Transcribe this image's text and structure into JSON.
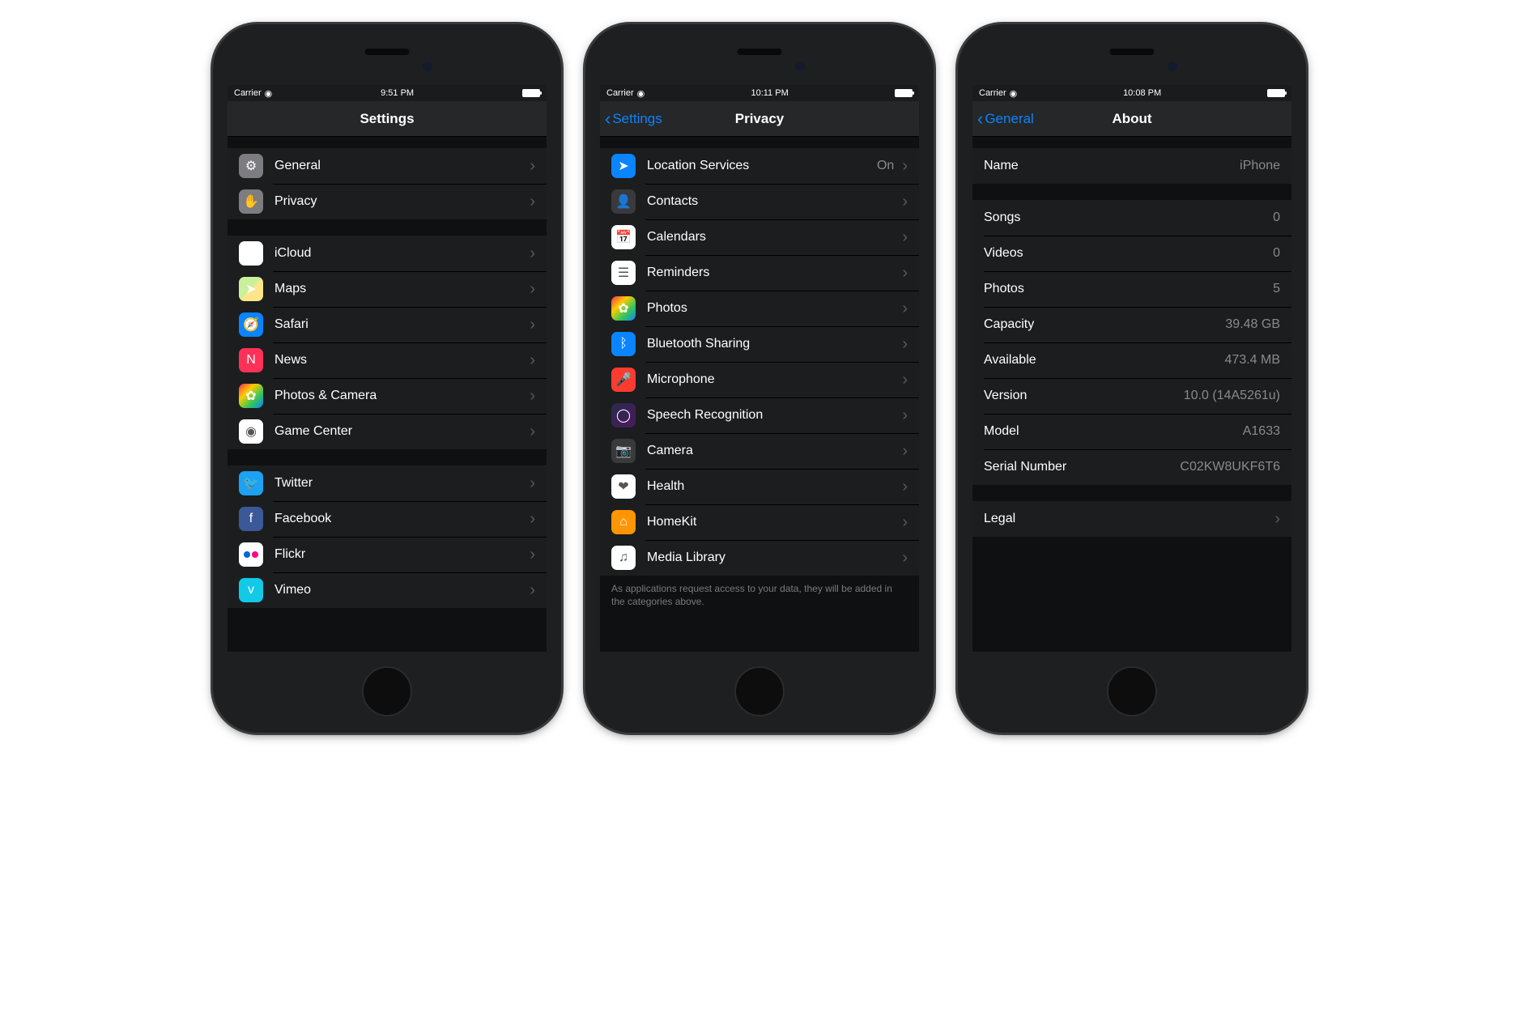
{
  "phones": [
    {
      "status": {
        "carrier": "Carrier",
        "time": "9:51 PM"
      },
      "nav": {
        "title": "Settings",
        "back": null
      },
      "groups": [
        {
          "rows": [
            {
              "icon": "gear-icon",
              "iconClass": "bg-gray",
              "glyph": "⚙",
              "label": "General",
              "disclosure": true
            },
            {
              "icon": "hand-icon",
              "iconClass": "bg-gray",
              "glyph": "✋",
              "label": "Privacy",
              "disclosure": true
            }
          ]
        },
        {
          "rows": [
            {
              "icon": "cloud-icon",
              "iconClass": "bg-icloud",
              "glyph": "☁︎",
              "label": "iCloud",
              "disclosure": true
            },
            {
              "icon": "maps-icon",
              "iconClass": "bg-maps",
              "glyph": "➤",
              "label": "Maps",
              "disclosure": true
            },
            {
              "icon": "compass-icon",
              "iconClass": "bg-blue",
              "glyph": "🧭",
              "label": "Safari",
              "disclosure": true
            },
            {
              "icon": "news-icon",
              "iconClass": "bg-news",
              "glyph": "N",
              "label": "News",
              "disclosure": true
            },
            {
              "icon": "photos-icon",
              "iconClass": "bg-multi",
              "glyph": "✿",
              "label": "Photos & Camera",
              "disclosure": true
            },
            {
              "icon": "gamecenter-icon",
              "iconClass": "bg-white",
              "glyph": "◉",
              "label": "Game Center",
              "disclosure": true
            }
          ]
        },
        {
          "rows": [
            {
              "icon": "twitter-icon",
              "iconClass": "bg-twitter",
              "glyph": "🐦",
              "label": "Twitter",
              "disclosure": true
            },
            {
              "icon": "facebook-icon",
              "iconClass": "bg-fb",
              "glyph": "f",
              "label": "Facebook",
              "disclosure": true
            },
            {
              "icon": "flickr-icon",
              "iconClass": "bg-flickr",
              "glyph": "",
              "label": "Flickr",
              "disclosure": true,
              "flickr": true
            },
            {
              "icon": "vimeo-icon",
              "iconClass": "bg-vimeo",
              "glyph": "v",
              "label": "Vimeo",
              "disclosure": true
            }
          ]
        }
      ]
    },
    {
      "status": {
        "carrier": "Carrier",
        "time": "10:11 PM"
      },
      "nav": {
        "title": "Privacy",
        "back": "Settings"
      },
      "groups": [
        {
          "rows": [
            {
              "icon": "location-icon",
              "iconClass": "bg-blue",
              "glyph": "➤",
              "label": "Location Services",
              "value": "On",
              "disclosure": true
            },
            {
              "icon": "contacts-icon",
              "iconClass": "bg-dark",
              "glyph": "👤",
              "label": "Contacts",
              "disclosure": true
            },
            {
              "icon": "calendar-icon",
              "iconClass": "bg-white",
              "glyph": "📅",
              "label": "Calendars",
              "disclosure": true
            },
            {
              "icon": "reminders-icon",
              "iconClass": "bg-white",
              "glyph": "☰",
              "label": "Reminders",
              "disclosure": true
            },
            {
              "icon": "photos-icon",
              "iconClass": "bg-multi",
              "glyph": "✿",
              "label": "Photos",
              "disclosure": true
            },
            {
              "icon": "bluetooth-icon",
              "iconClass": "bg-blue",
              "glyph": "ᛒ",
              "label": "Bluetooth Sharing",
              "disclosure": true
            },
            {
              "icon": "microphone-icon",
              "iconClass": "bg-red",
              "glyph": "🎤",
              "label": "Microphone",
              "disclosure": true
            },
            {
              "icon": "siri-icon",
              "iconClass": "bg-siri",
              "glyph": "◯",
              "label": "Speech Recognition",
              "disclosure": true
            },
            {
              "icon": "camera-icon",
              "iconClass": "bg-dark",
              "glyph": "📷",
              "label": "Camera",
              "disclosure": true
            },
            {
              "icon": "health-icon",
              "iconClass": "bg-white",
              "glyph": "❤︎",
              "label": "Health",
              "disclosure": true
            },
            {
              "icon": "homekit-icon",
              "iconClass": "bg-orange",
              "glyph": "⌂",
              "label": "HomeKit",
              "disclosure": true
            },
            {
              "icon": "music-icon",
              "iconClass": "bg-white",
              "glyph": "♫",
              "label": "Media Library",
              "disclosure": true
            }
          ],
          "footer": "As applications request access to your data, they will be added in the categories above."
        }
      ]
    },
    {
      "status": {
        "carrier": "Carrier",
        "time": "10:08 PM"
      },
      "nav": {
        "title": "About",
        "back": "General"
      },
      "groups": [
        {
          "rows": [
            {
              "noicon": true,
              "label": "Name",
              "value": "iPhone",
              "disclosure": false
            }
          ]
        },
        {
          "rows": [
            {
              "noicon": true,
              "label": "Songs",
              "value": "0"
            },
            {
              "noicon": true,
              "label": "Videos",
              "value": "0"
            },
            {
              "noicon": true,
              "label": "Photos",
              "value": "5"
            },
            {
              "noicon": true,
              "label": "Capacity",
              "value": "39.48 GB"
            },
            {
              "noicon": true,
              "label": "Available",
              "value": "473.4 MB"
            },
            {
              "noicon": true,
              "label": "Version",
              "value": "10.0 (14A5261u)"
            },
            {
              "noicon": true,
              "label": "Model",
              "value": "A1633"
            },
            {
              "noicon": true,
              "label": "Serial Number",
              "value": "C02KW8UKF6T6"
            }
          ]
        },
        {
          "rows": [
            {
              "noicon": true,
              "label": "Legal",
              "disclosure": true
            }
          ]
        }
      ]
    }
  ]
}
